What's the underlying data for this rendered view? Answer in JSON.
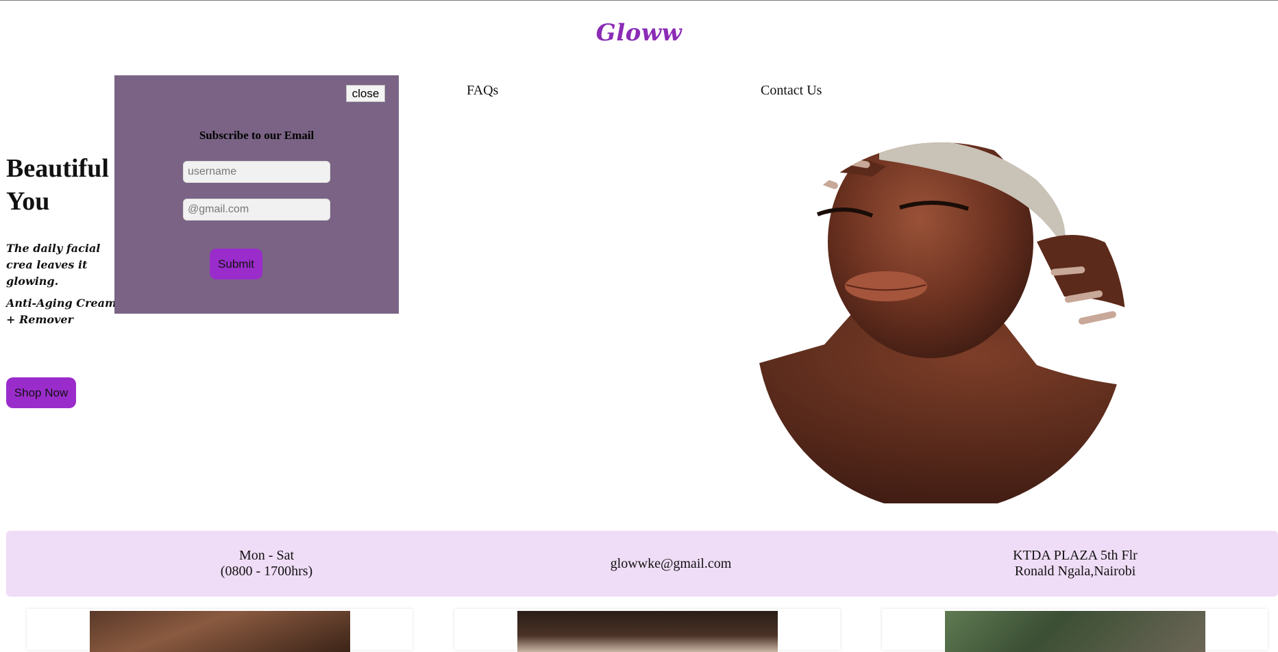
{
  "brand": {
    "name": "Gloww",
    "color": "#8b2cb6"
  },
  "nav": {
    "links": [
      {
        "label": "FAQs"
      },
      {
        "label": "Contact Us"
      }
    ]
  },
  "hero": {
    "title": "Beautiful You",
    "subtitle": "The daily facial crea leaves it glowing.",
    "product": "Anti-Aging Cream + Remover",
    "cta_label": "Shop Now",
    "image_icon": "portrait-circle-image"
  },
  "modal": {
    "close_label": "close",
    "title": "Subscribe to our Email",
    "username_placeholder": "username",
    "email_placeholder": "@gmail.com",
    "submit_label": "Submit",
    "background": "#7a6384"
  },
  "info": {
    "hours_line1": "Mon - Sat",
    "hours_line2": "(0800 - 1700hrs)",
    "email": "glowwke@gmail.com",
    "address_line1": "KTDA PLAZA 5th Flr",
    "address_line2": "Ronald Ngala,Nairobi",
    "background": "#efdcf6"
  },
  "accent_color": "#9b2ccc"
}
